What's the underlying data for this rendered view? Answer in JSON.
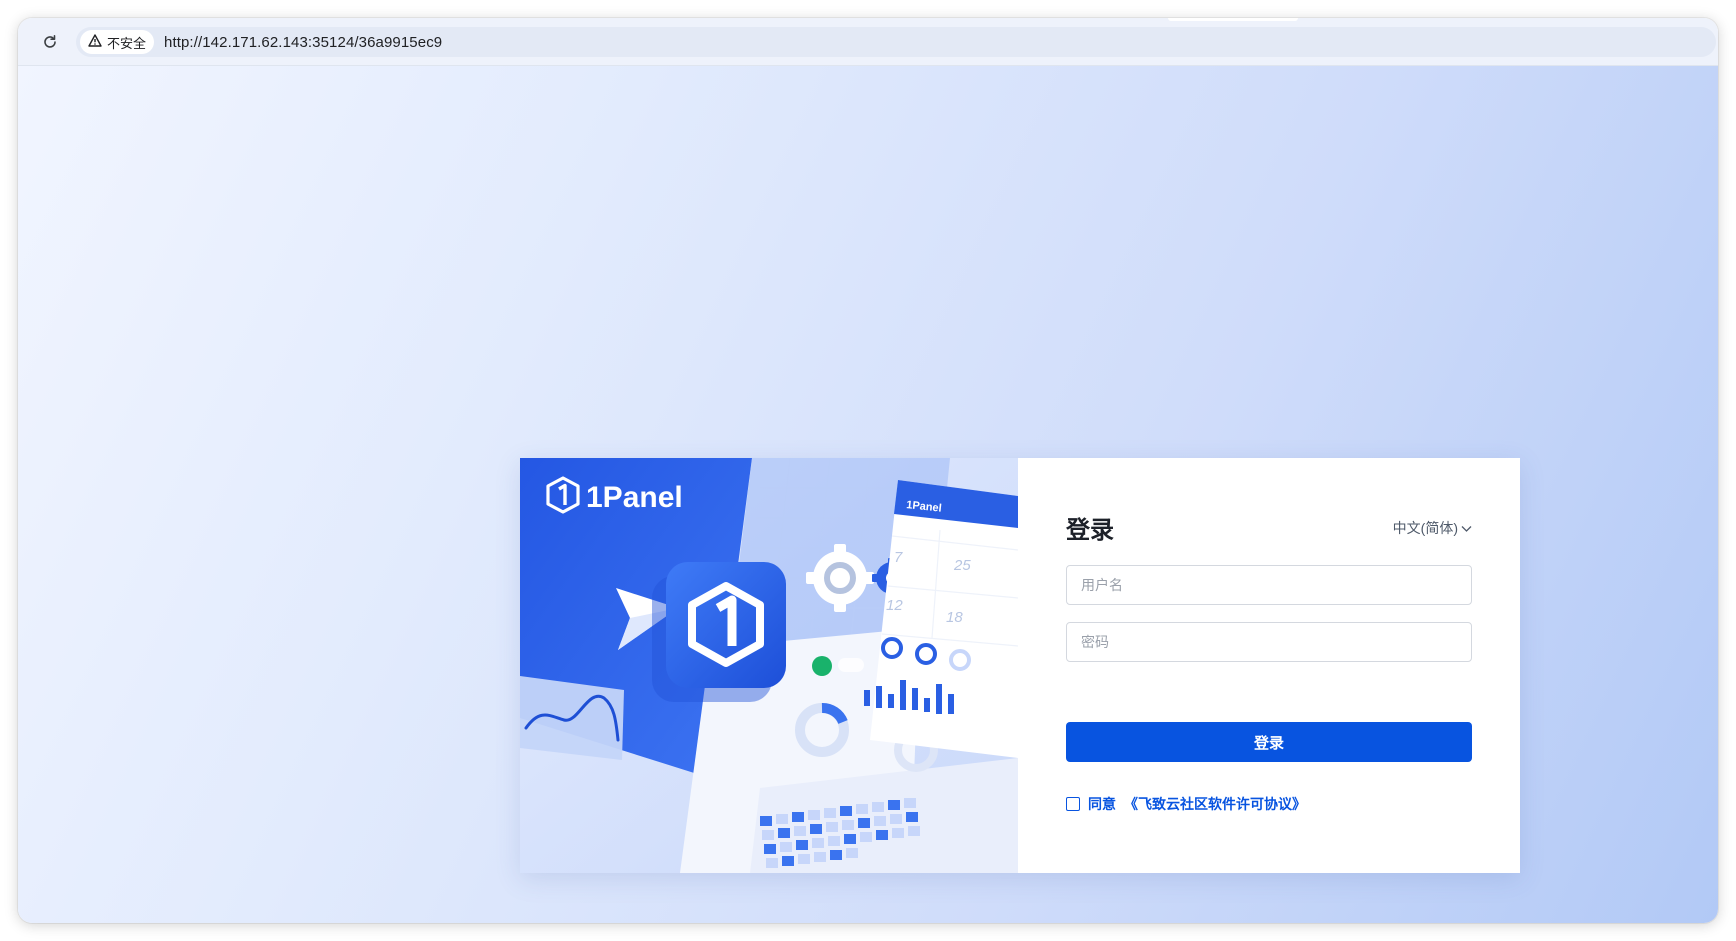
{
  "browser": {
    "security_label": "不安全",
    "url": "http://142.171.62.143:35124/36a9915ec9"
  },
  "banner": {
    "brand": "1Panel",
    "mini_brand": "1Panel",
    "calendar_numbers": [
      "7",
      "25",
      "12",
      "18"
    ]
  },
  "login": {
    "title": "登录",
    "language": "中文(简体)",
    "username_placeholder": "用户名",
    "password_placeholder": "密码",
    "submit_label": "登录",
    "agree_prefix": "同意",
    "agree_link": "《飞致云社区软件许可协议》"
  },
  "colors": {
    "primary": "#0854e0",
    "banner_blue": "#2b5fe6"
  }
}
